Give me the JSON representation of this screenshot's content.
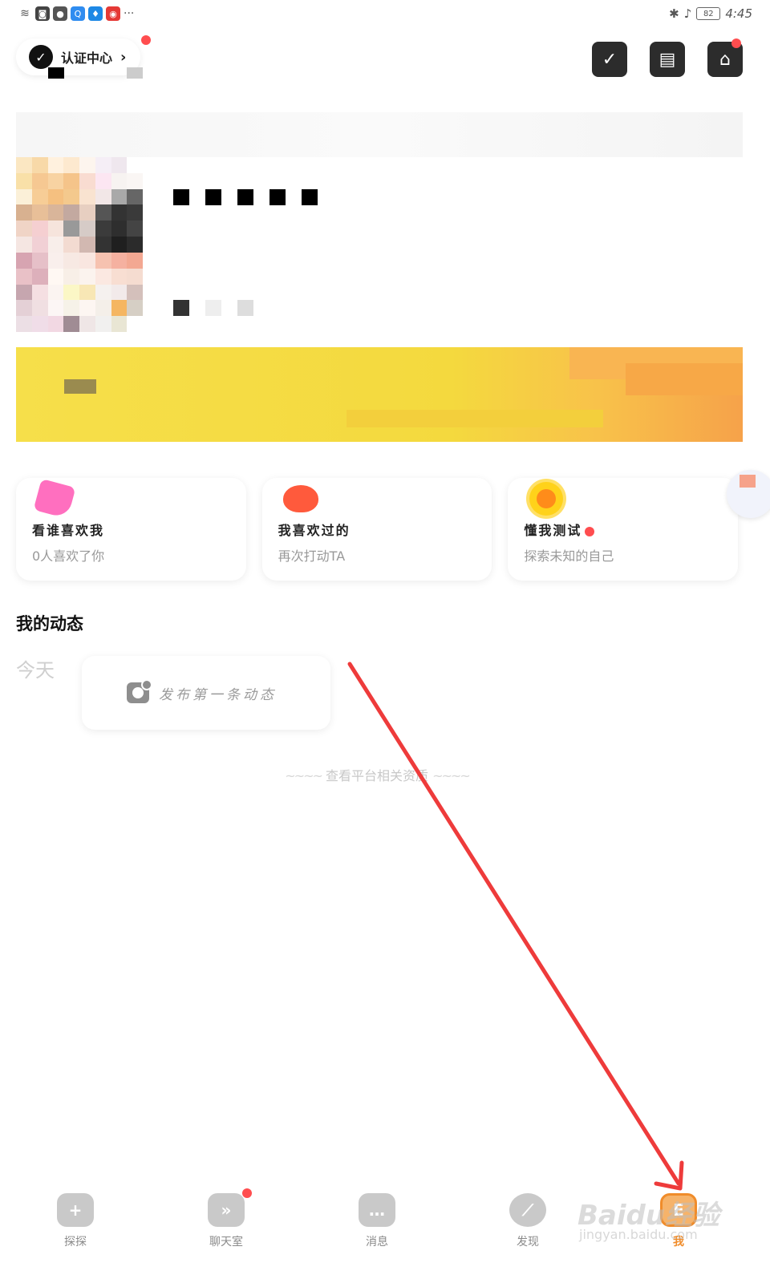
{
  "status_bar": {
    "time": "4:45",
    "battery": "82",
    "left_icons": [
      "wifi-icon",
      "chat-bot-icon",
      "wechat-icon",
      "search-app-icon",
      "bulb-app-icon",
      "weibo-icon"
    ],
    "more": "···"
  },
  "header": {
    "cert_label": "认证中心",
    "cert_arrow": "›",
    "icons": [
      "clipboard-check-icon",
      "wallet-icon",
      "home-settings-icon"
    ]
  },
  "cards": [
    {
      "title": "看谁喜欢我",
      "subtitle": "0人喜欢了你"
    },
    {
      "title": "我喜欢过的",
      "subtitle": "再次打动TA"
    },
    {
      "title": "懂我测试",
      "subtitle": "探索未知的自己"
    }
  ],
  "moments": {
    "section_title": "我的动态",
    "today_label": "今天",
    "publish_label": "发布第一条动态",
    "platform_link": "查看平台相关资质",
    "wave": "~~~~"
  },
  "bottom_nav": [
    {
      "label": "探探",
      "icon": "swipe-icon"
    },
    {
      "label": "聊天室",
      "icon": "chatroom-icon"
    },
    {
      "label": "消息",
      "icon": "message-icon"
    },
    {
      "label": "发现",
      "icon": "discover-icon"
    },
    {
      "label": "我",
      "icon": "profile-icon"
    }
  ],
  "watermark": {
    "main": "Baidu经验",
    "sub": "jingyan.baidu.com"
  },
  "colors": {
    "accent_orange": "#f08c2a",
    "badge_red": "#ff4d4f",
    "banner_yellow": "#f4d93e",
    "annotation_red": "#ee3b3b"
  }
}
